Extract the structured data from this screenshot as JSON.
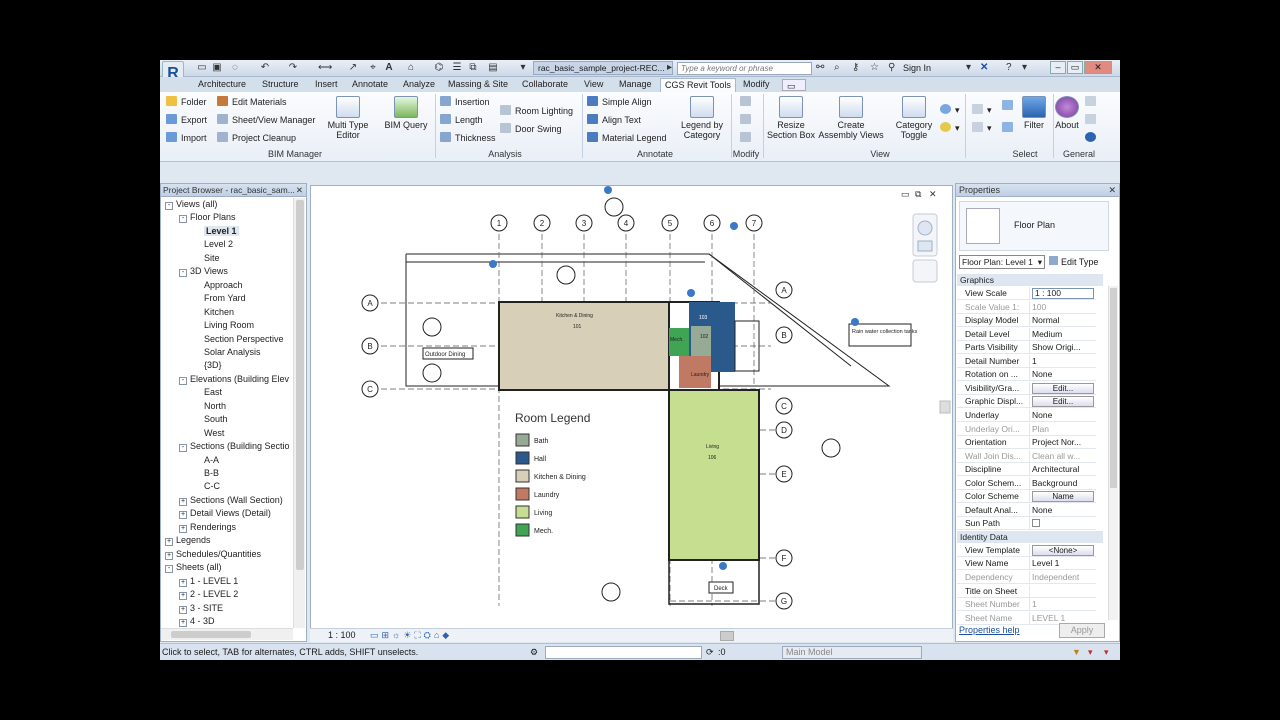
{
  "titlebar": {
    "app_letter": "R",
    "doc_tab": "rac_basic_sample_project-REC...",
    "search_placeholder": "Type a keyword or phrase",
    "sign_in": "Sign In"
  },
  "tabs": [
    "Architecture",
    "Structure",
    "Insert",
    "Annotate",
    "Analyze",
    "Massing & Site",
    "Collaborate",
    "View",
    "Manage",
    "CGS Revit Tools",
    "Modify"
  ],
  "active_tab": "CGS Revit Tools",
  "ribbon": {
    "bim_manager": {
      "title": "BIM Manager",
      "col1": [
        "Folder",
        "Export",
        "Import"
      ],
      "col2": [
        "Edit Materials",
        "Sheet/View Manager",
        "Project Cleanup"
      ],
      "large": [
        "Multi Type Editor",
        "BIM Query"
      ]
    },
    "analysis": {
      "title": "Analysis",
      "col1": [
        "Insertion",
        "Length",
        "Thickness"
      ],
      "col2": [
        "Room Lighting",
        "Door Swing"
      ]
    },
    "annotate": {
      "title": "Annotate",
      "col1": [
        "Simple Align",
        "Align Text",
        "Material Legend"
      ],
      "large": [
        "Legend by Category"
      ]
    },
    "modify": {
      "title": "Modify"
    },
    "view": {
      "title": "View",
      "large": [
        "Resize Section Box",
        "Create Assembly Views",
        "Category Toggle"
      ]
    },
    "select": {
      "title": "Select",
      "large": [
        "Filter"
      ]
    },
    "general": {
      "title": "General",
      "large": [
        "About"
      ]
    }
  },
  "project_browser": {
    "title": "Project Browser - rac_basic_sam...",
    "tree": [
      {
        "label": "Views (all)",
        "level": 0,
        "pm": "-"
      },
      {
        "label": "Floor Plans",
        "level": 1,
        "pm": "-"
      },
      {
        "label": "Level 1",
        "level": 2,
        "selected": true
      },
      {
        "label": "Level 2",
        "level": 2
      },
      {
        "label": "Site",
        "level": 2
      },
      {
        "label": "3D Views",
        "level": 1,
        "pm": "-"
      },
      {
        "label": "Approach",
        "level": 2
      },
      {
        "label": "From Yard",
        "level": 2
      },
      {
        "label": "Kitchen",
        "level": 2
      },
      {
        "label": "Living Room",
        "level": 2
      },
      {
        "label": "Section Perspective",
        "level": 2
      },
      {
        "label": "Solar Analysis",
        "level": 2
      },
      {
        "label": "{3D}",
        "level": 2
      },
      {
        "label": "Elevations (Building Elev",
        "level": 1,
        "pm": "-"
      },
      {
        "label": "East",
        "level": 2
      },
      {
        "label": "North",
        "level": 2
      },
      {
        "label": "South",
        "level": 2
      },
      {
        "label": "West",
        "level": 2
      },
      {
        "label": "Sections (Building Sectio",
        "level": 1,
        "pm": "-"
      },
      {
        "label": "A-A",
        "level": 2
      },
      {
        "label": "B-B",
        "level": 2
      },
      {
        "label": "C-C",
        "level": 2
      },
      {
        "label": "Sections (Wall Section)",
        "level": 1,
        "pm": "+"
      },
      {
        "label": "Detail Views (Detail)",
        "level": 1,
        "pm": "+"
      },
      {
        "label": "Renderings",
        "level": 1,
        "pm": "+"
      },
      {
        "label": "Legends",
        "level": 0,
        "pm": "+"
      },
      {
        "label": "Schedules/Quantities",
        "level": 0,
        "pm": "+"
      },
      {
        "label": "Sheets (all)",
        "level": 0,
        "pm": "-"
      },
      {
        "label": "1 - LEVEL 1",
        "level": 1,
        "pm": "+"
      },
      {
        "label": "2 - LEVEL 2",
        "level": 1,
        "pm": "+"
      },
      {
        "label": "3 - SITE",
        "level": 1,
        "pm": "+"
      },
      {
        "label": "4 - 3D",
        "level": 1,
        "pm": "+"
      }
    ]
  },
  "drawing": {
    "grid_numbers": [
      "1",
      "2",
      "3",
      "4",
      "5",
      "6",
      "7"
    ],
    "grid_letters_left": [
      "A",
      "B",
      "C"
    ],
    "grid_letters_right": [
      "A",
      "B",
      "C",
      "D",
      "E",
      "F",
      "G"
    ],
    "legend_title": "Room Legend",
    "legend": [
      {
        "label": "Bath",
        "color": "#96aa96"
      },
      {
        "label": "Hall",
        "color": "#2a5a8c"
      },
      {
        "label": "Kitchen & Dining",
        "color": "#d8cfb9"
      },
      {
        "label": "Laundry",
        "color": "#c07a64"
      },
      {
        "label": "Living",
        "color": "#c6de8f"
      },
      {
        "label": "Mech.",
        "color": "#3fa454"
      }
    ],
    "rooms": {
      "kitchen": "Kitchen & Dining",
      "living": "Living",
      "outdoor": "Outdoor Dining",
      "deck": "Deck",
      "laundry": "Laundry",
      "mech": "Mech."
    },
    "room_nums": {
      "kitchen": "101",
      "living": "106",
      "hall": "103",
      "bath": "102"
    },
    "note": "Rain water collection tanks",
    "scale": "1 : 100"
  },
  "properties": {
    "title": "Properties",
    "type_name": "Floor Plan",
    "view_selector": "Floor Plan: Level 1",
    "edit_type": "Edit Type",
    "groups": [
      {
        "name": "Graphics",
        "rows": [
          {
            "k": "View Scale",
            "v": "1 : 100",
            "input": true
          },
          {
            "k": "Scale Value   1:",
            "v": "100",
            "dim": true
          },
          {
            "k": "Display Model",
            "v": "Normal"
          },
          {
            "k": "Detail Level",
            "v": "Medium"
          },
          {
            "k": "Parts Visibility",
            "v": "Show Origi..."
          },
          {
            "k": "Detail Number",
            "v": "1"
          },
          {
            "k": "Rotation on ...",
            "v": "None"
          },
          {
            "k": "Visibility/Gra...",
            "v": "Edit...",
            "btn": true
          },
          {
            "k": "Graphic Displ...",
            "v": "Edit...",
            "btn": true
          },
          {
            "k": "Underlay",
            "v": "None"
          },
          {
            "k": "Underlay Ori...",
            "v": "Plan",
            "dim": true
          },
          {
            "k": "Orientation",
            "v": "Project Nor..."
          },
          {
            "k": "Wall Join Dis...",
            "v": "Clean all w...",
            "dim": true
          },
          {
            "k": "Discipline",
            "v": "Architectural"
          },
          {
            "k": "Color Schem...",
            "v": "Background"
          },
          {
            "k": "Color Scheme",
            "v": "Name",
            "btn": true
          },
          {
            "k": "Default Anal...",
            "v": "None"
          },
          {
            "k": "Sun Path",
            "v": "",
            "check": true
          }
        ]
      },
      {
        "name": "Identity Data",
        "rows": [
          {
            "k": "View Template",
            "v": "<None>",
            "btn": true
          },
          {
            "k": "View Name",
            "v": "Level 1"
          },
          {
            "k": "Dependency",
            "v": "Independent",
            "dim": true
          },
          {
            "k": "Title on Sheet",
            "v": ""
          },
          {
            "k": "Sheet Number",
            "v": "1",
            "dim": true
          },
          {
            "k": "Sheet Name",
            "v": "LEVEL 1",
            "dim": true
          }
        ]
      }
    ],
    "help": "Properties help",
    "apply": "Apply"
  },
  "status": {
    "hint": "Click to select, TAB for alternates, CTRL adds, SHIFT unselects.",
    "zero": ":0",
    "model": "Main Model"
  }
}
